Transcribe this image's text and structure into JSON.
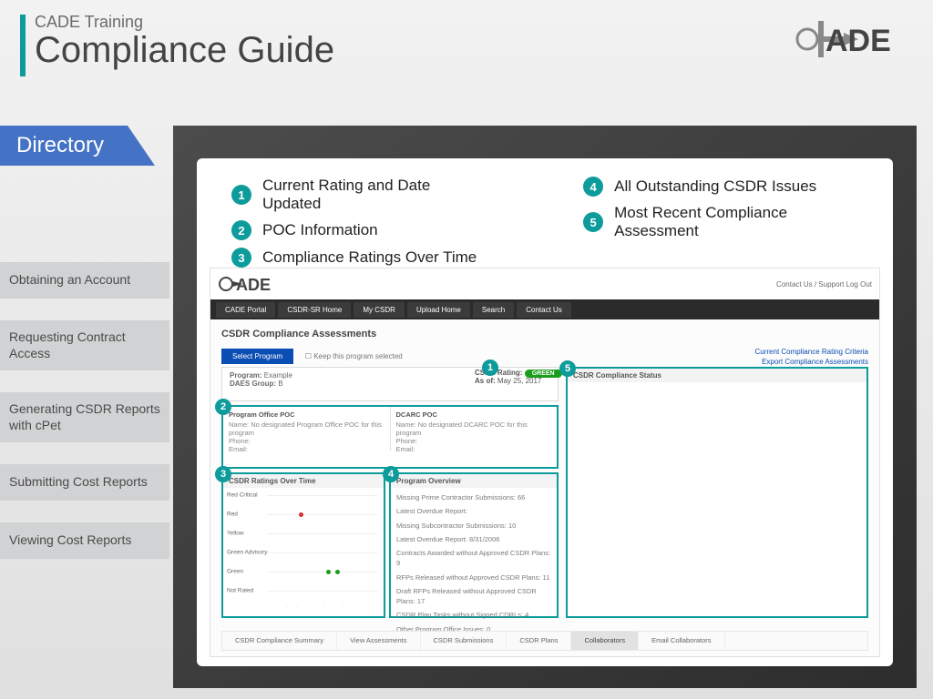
{
  "header": {
    "sub": "CADE Training",
    "title": "Compliance Guide"
  },
  "directory_label": "Directory",
  "sidebar": {
    "items": [
      {
        "label": "Obtaining an Account"
      },
      {
        "label": "Requesting Contract Access"
      },
      {
        "label": "Generating CSDR Reports with cPet"
      },
      {
        "label": "Submitting Cost Reports"
      },
      {
        "label": "Viewing Cost Reports"
      }
    ]
  },
  "legend": {
    "left": [
      {
        "n": "1",
        "label": "Current Rating and Date Updated"
      },
      {
        "n": "2",
        "label": "POC Information"
      },
      {
        "n": "3",
        "label": "Compliance Ratings Over Time"
      }
    ],
    "right": [
      {
        "n": "4",
        "label": "All Outstanding CSDR Issues"
      },
      {
        "n": "5",
        "label": "Most Recent Compliance Assessment"
      }
    ]
  },
  "mini": {
    "top_links": "Contact Us / Support    Log Out",
    "nav": [
      "CADE Portal",
      "CSDR-SR Home",
      "My CSDR",
      "Upload Home",
      "Search",
      "Contact Us"
    ],
    "page_title": "CSDR Compliance Assessments",
    "select_btn": "Select Program",
    "keep": "Keep this program selected",
    "links_right": [
      "Current Compliance Rating Criteria",
      "Export Compliance Assessments"
    ],
    "program": {
      "label": "Program:",
      "value": "Example",
      "group_label": "DAES Group:",
      "group_value": "B"
    },
    "rating": {
      "label": "CSDR Rating:",
      "value": "GREEN",
      "asof_label": "As of:",
      "asof_value": "May 25, 2017"
    },
    "poc": {
      "hdr": "Program Office POC",
      "left": {
        "name": "Name:",
        "name_v": "No designated Program Office POC for this program",
        "phone": "Phone:",
        "email": "Email:"
      },
      "right_hdr": "DCARC POC",
      "right": {
        "name": "Name:",
        "name_v": "No designated DCARC POC for this program",
        "phone": "Phone:",
        "email": "Email:"
      }
    },
    "chart": {
      "hdr": "CSDR Ratings Over Time"
    },
    "overview": {
      "hdr": "Program Overview",
      "rows": [
        "Missing Prime Contractor Submissions: 66",
        "Latest Overdue Report:",
        "Missing Subcontractor Submissions: 10",
        "Latest Overdue Report: 8/31/2006",
        "Contracts Awarded without Approved CSDR Plans: 9",
        "RFPs Released without Approved CSDR Plans: 11",
        "Draft RFPs Released without Approved CSDR Plans: 17",
        "CSDR Plan Tasks without Signed CDRLs: 4",
        "Other Program Office Issues: 0"
      ]
    },
    "status": {
      "hdr": "CSDR Compliance Status"
    },
    "btabs": [
      "CSDR Compliance Summary",
      "View Assessments",
      "CSDR Submissions",
      "CSDR Plans",
      "Collaborators",
      "Email Collaborators"
    ],
    "btab_active": 4
  },
  "chart_data": {
    "type": "scatter",
    "title": "CSDR Ratings Over Time",
    "y_categories": [
      "Red Critical",
      "Red",
      "Yellow",
      "Green Advisory",
      "Green",
      "Not Rated"
    ],
    "x": [
      "p1",
      "p2",
      "p3",
      "p4",
      "p5",
      "p6",
      "p7",
      "p8",
      "p9",
      "p10",
      "p11",
      "p12"
    ],
    "points": [
      {
        "x_index": 3,
        "y": "Red",
        "color": "#d62f2f"
      },
      {
        "x_index": 6,
        "y": "Green",
        "color": "#1a9e1a"
      },
      {
        "x_index": 7,
        "y": "Green",
        "color": "#1a9e1a"
      }
    ]
  }
}
